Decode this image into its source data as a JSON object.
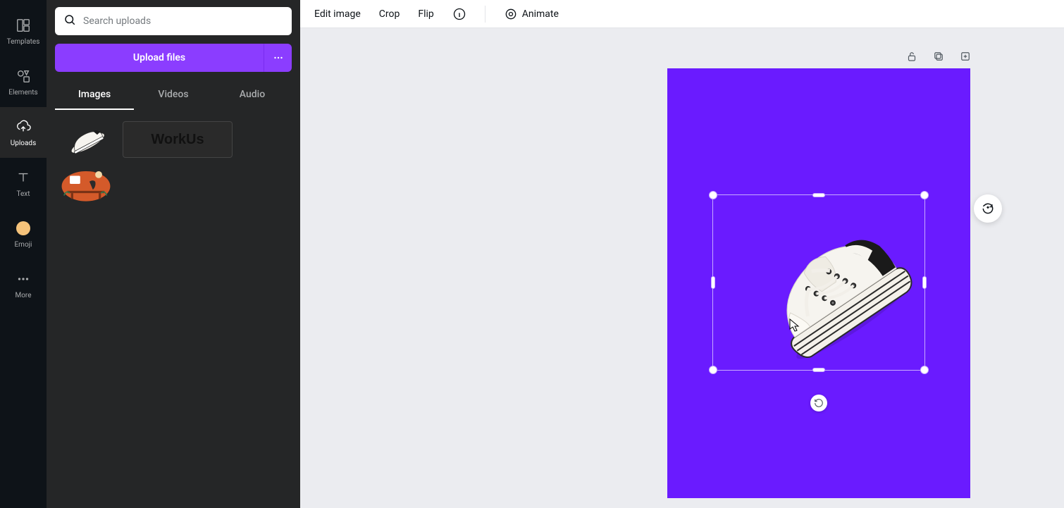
{
  "rail": {
    "items": [
      {
        "name": "templates",
        "label": "Templates"
      },
      {
        "name": "elements",
        "label": "Elements"
      },
      {
        "name": "uploads",
        "label": "Uploads"
      },
      {
        "name": "text",
        "label": "Text"
      },
      {
        "name": "emoji",
        "label": "Emoji"
      },
      {
        "name": "more",
        "label": "More"
      }
    ],
    "active_index": 2
  },
  "panel": {
    "search_placeholder": "Search uploads",
    "upload_label": "Upload files",
    "tabs": [
      {
        "label": "Images",
        "active": true
      },
      {
        "label": "Videos",
        "active": false
      },
      {
        "label": "Audio",
        "active": false
      }
    ],
    "thumbs": {
      "workus_text": "WorkUs"
    }
  },
  "topbar": {
    "edit_image": "Edit image",
    "crop": "Crop",
    "flip": "Flip",
    "animate": "Animate"
  },
  "canvas": {
    "page_bg": "#6a1bff"
  }
}
